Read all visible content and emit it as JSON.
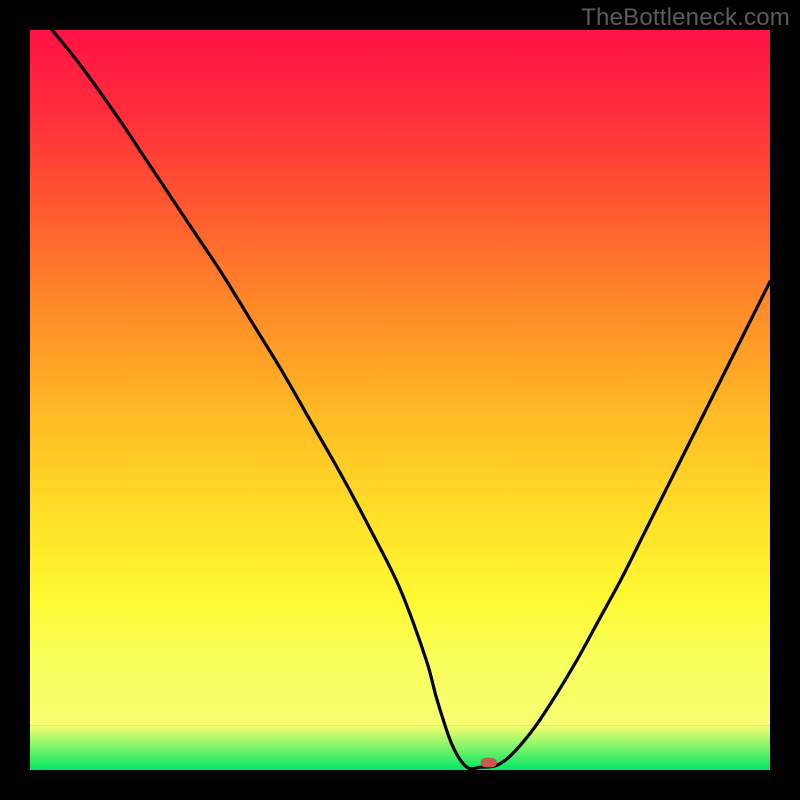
{
  "watermark": "TheBottleneck.com",
  "chart_data": {
    "type": "line",
    "title": "",
    "xlabel": "",
    "ylabel": "",
    "xlim": [
      0,
      100
    ],
    "ylim": [
      0,
      100
    ],
    "grid": false,
    "series": [
      {
        "name": "curve",
        "x": [
          3,
          7,
          12,
          15,
          18,
          22,
          26,
          30,
          34,
          38,
          42,
          46,
          50,
          53.5,
          55,
          57,
          59,
          61,
          63,
          65,
          68,
          71,
          74,
          77,
          80,
          83,
          86,
          89,
          92,
          95,
          98,
          100
        ],
        "y": [
          100,
          95,
          88,
          83.5,
          79,
          73,
          67,
          60.5,
          54,
          47,
          40,
          32.5,
          24.5,
          15,
          9.5,
          3.5,
          0.4,
          0.4,
          0.6,
          2.0,
          5.5,
          10,
          15,
          20.5,
          26,
          32,
          38,
          44,
          50,
          56,
          62,
          66
        ]
      }
    ],
    "baseline_band": {
      "top": 94,
      "bottom": 100,
      "color_top": "#f6ff71",
      "color_bottom": "#00e763"
    },
    "marker": {
      "x": 62,
      "y": 99,
      "shape": "rounded-rect",
      "color": "#c85a50",
      "width_pct": 2.2,
      "height_pct": 1.3
    },
    "background_gradient": {
      "stops": [
        {
          "pos": 0.0,
          "color": "#ff1244"
        },
        {
          "pos": 0.12,
          "color": "#ff2d3b"
        },
        {
          "pos": 0.25,
          "color": "#ff5730"
        },
        {
          "pos": 0.4,
          "color": "#ff8a28"
        },
        {
          "pos": 0.55,
          "color": "#ffba25"
        },
        {
          "pos": 0.7,
          "color": "#ffe028"
        },
        {
          "pos": 0.82,
          "color": "#fff933"
        },
        {
          "pos": 0.9,
          "color": "#f9ff5a"
        }
      ]
    }
  }
}
